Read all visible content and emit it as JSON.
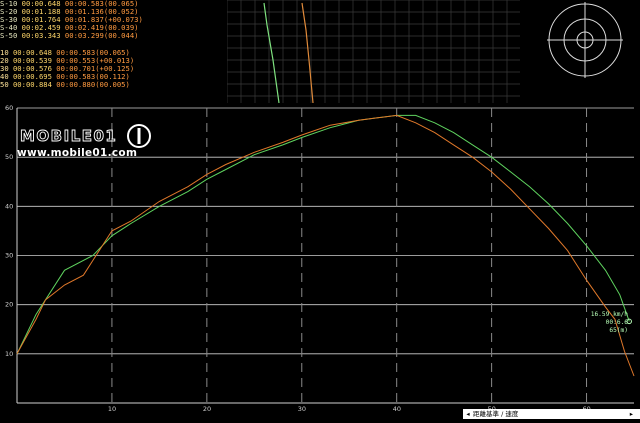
{
  "timing_table": {
    "group1": [
      {
        "label": "S-10",
        "t1": "00:00.648",
        "t2": "00:00.583",
        "diff": "(00.065)"
      },
      {
        "label": "S-20",
        "t1": "00:01.188",
        "t2": "00:01.136",
        "diff": "(00.052)"
      },
      {
        "label": "S-30",
        "t1": "00:01.764",
        "t2": "00:01.837",
        "diff": "(+00.073)"
      },
      {
        "label": "S-40",
        "t1": "00:02.459",
        "t2": "00:02.419",
        "diff": "(00.039)"
      },
      {
        "label": "S-50",
        "t1": "00:03.343",
        "t2": "00:03.299",
        "diff": "(00.044)"
      }
    ],
    "group2": [
      {
        "label": "10",
        "t1": "00:00.648",
        "t2": "00:00.583",
        "diff": "(00.065)"
      },
      {
        "label": "20",
        "t1": "00:00.539",
        "t2": "00:00.553",
        "diff": "(+00.013)"
      },
      {
        "label": "30",
        "t1": "00:00.576",
        "t2": "00:00.701",
        "diff": "(+00.125)"
      },
      {
        "label": "40",
        "t1": "00:00.695",
        "t2": "00:00.583",
        "diff": "(00.112)"
      },
      {
        "label": "50",
        "t1": "00:00.884",
        "t2": "00:00.880",
        "diff": "(00.005)"
      }
    ]
  },
  "logo": {
    "text": "MOBILE01",
    "url": "www.mobile01.com"
  },
  "readout": {
    "speed": "16.59 km/h",
    "time": "00:6.6",
    "distance": "65(m)"
  },
  "status_bar": {
    "arrow_left": "◂",
    "arrow_right": "▸",
    "mode": "距離基準 / 速度"
  },
  "colors": {
    "series_green": "#5fd35f",
    "series_orange": "#e0782a",
    "grid_line": "#cfcfcf",
    "grid_dashed": "#8a8a8a"
  },
  "chart_data": {
    "type": "line",
    "xlim": [
      0,
      65
    ],
    "ylim": [
      0,
      60
    ],
    "x_ticks": [
      "10",
      "20",
      "30",
      "40",
      "50",
      "60"
    ],
    "y_ticks": [
      "10",
      "20",
      "30",
      "40",
      "50",
      "60"
    ],
    "series": [
      {
        "color": "#5fd35f",
        "x": [
          0,
          2,
          5,
          8,
          10,
          12,
          15,
          18,
          20,
          22,
          25,
          28,
          30,
          33,
          36,
          38,
          40,
          42,
          44,
          46,
          48,
          50,
          52,
          54,
          56,
          58,
          60,
          62,
          63.5,
          64.5
        ],
        "y": [
          10,
          18,
          27,
          30,
          34,
          36.5,
          40,
          43,
          45.5,
          47.5,
          50.5,
          52.5,
          54,
          56,
          57.5,
          58,
          58.5,
          58.5,
          57,
          55,
          52.5,
          50,
          47,
          44,
          40.5,
          36.5,
          32,
          27,
          22,
          16.6
        ]
      },
      {
        "color": "#e0782a",
        "x": [
          0,
          2,
          3,
          5,
          7,
          8,
          10,
          12,
          15,
          18,
          20,
          22,
          25,
          28,
          30,
          33,
          36,
          38,
          40,
          42,
          44,
          46,
          48,
          50,
          52,
          54,
          56,
          58,
          60,
          62,
          63,
          64,
          65
        ],
        "y": [
          10,
          17,
          21,
          24,
          26,
          29,
          35,
          37,
          41,
          44,
          46.5,
          48.5,
          51,
          53,
          54.5,
          56.5,
          57.5,
          58,
          58.5,
          57,
          55,
          52.5,
          50,
          47,
          43.5,
          39.5,
          35.5,
          31,
          25,
          19.5,
          17,
          10.5,
          5.5
        ]
      }
    ]
  }
}
